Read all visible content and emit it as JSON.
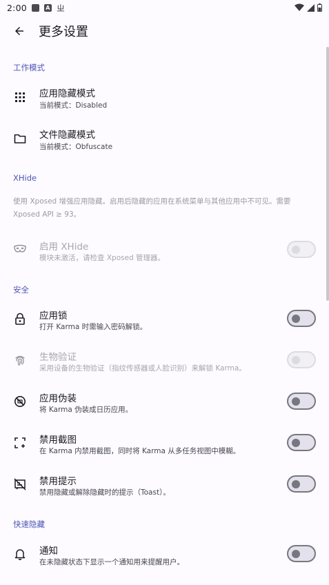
{
  "status_bar": {
    "time": "2:00",
    "glyph": "ㄓ"
  },
  "app_bar": {
    "title": "更多设置"
  },
  "sections": {
    "work_mode": {
      "header": "工作模式",
      "app_hide": {
        "title": "应用隐藏模式",
        "summary": "当前模式：Disabled"
      },
      "file_hide": {
        "title": "文件隐藏模式",
        "summary": "当前模式：Obfuscate"
      }
    },
    "xhide": {
      "header": "XHide",
      "description": "使用 Xposed 增强应用隐藏。启用后隐藏的应用在系统菜单与其他应用中不可见。需要 Xposed API ≥ 93。",
      "enable": {
        "title": "启用 XHide",
        "summary": "模块未激活，请检查 Xposed 管理器。",
        "checked": false,
        "enabled": false
      }
    },
    "security": {
      "header": "安全",
      "app_lock": {
        "title": "应用锁",
        "summary": "打开 Karma 时需输入密码解锁。",
        "checked": false
      },
      "biometric": {
        "title": "生物验证",
        "summary": "采用设备的生物验证（指纹传感器或人脸识别）来解锁 Karma。",
        "checked": false,
        "enabled": false
      },
      "disguise": {
        "title": "应用伪装",
        "summary": "将 Karma 伪装成日历应用。",
        "checked": false
      },
      "no_screenshot": {
        "title": "禁用截图",
        "summary": "在 Karma 内禁用截图，同时将 Karma 从多任务视图中模糊。",
        "checked": false
      },
      "no_toast": {
        "title": "禁用提示",
        "summary": "禁用隐藏或解除隐藏时的提示（Toast）。",
        "checked": false
      }
    },
    "quick_hide": {
      "header": "快速隐藏",
      "notification": {
        "title": "通知",
        "summary": "在未隐藏状态下显示一个通知用来提醒用户。",
        "checked": false
      }
    }
  },
  "colors": {
    "accent": "#4f55b6",
    "background": "#fdfbff",
    "switch_off_track": "#e3e1ec",
    "switch_off_outline": "#77777f"
  }
}
